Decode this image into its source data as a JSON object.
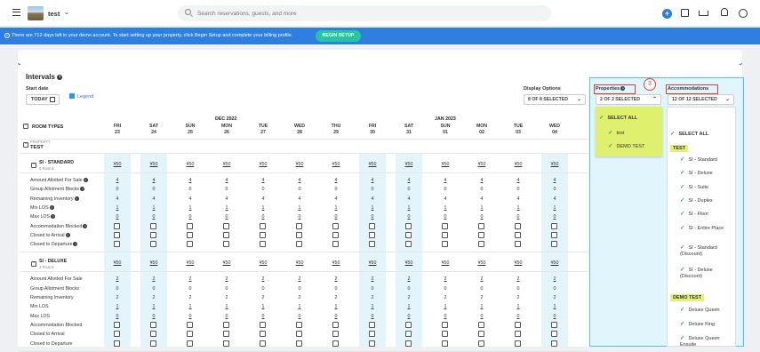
{
  "topbar": {
    "property_name": "test",
    "search_placeholder": "Search reservations, guests, and more"
  },
  "banner": {
    "info": "i",
    "message": "There are 712 days left in your demo account. To start setting up your property, click Begin Setup and complete your billing profile.",
    "button": "BEGIN SETUP"
  },
  "intervals": {
    "title": "Intervals",
    "start_date_label": "Start date",
    "today_button": "TODAY",
    "legend": "Legend",
    "display_options_label": "Display Options",
    "display_options_value": "8 OF 8 SELECTED",
    "properties_label": "Properties",
    "properties_value": "2 OF 2 SELECTED",
    "accommodations_label": "Accommodations",
    "accommodations_value": "12 OF 12 SELECTED",
    "room_types_header": "ROOM TYPES",
    "month1": "DEC 2022",
    "month2": "JAN 2023",
    "property_label": "PROPERTY",
    "property_name": "TEST"
  },
  "days": [
    [
      "FRI",
      "23"
    ],
    [
      "SAT",
      "24"
    ],
    [
      "SUN",
      "25"
    ],
    [
      "MON",
      "26"
    ],
    [
      "TUE",
      "27"
    ],
    [
      "WED",
      "28"
    ],
    [
      "THU",
      "29"
    ],
    [
      "FRI",
      "30"
    ],
    [
      "SAT",
      "31"
    ],
    [
      "SUN",
      "01"
    ],
    [
      "MON",
      "02"
    ],
    [
      "TUE",
      "03"
    ],
    [
      "WED",
      "04"
    ]
  ],
  "room_blocks": [
    {
      "name": "SI - STANDARD",
      "rooms": "4 Rooms",
      "rate": "¥50",
      "rows": [
        {
          "label": "Amount Allotted For Sale",
          "help": true,
          "value": "4",
          "type": "link"
        },
        {
          "label": "Group Allotment Blocks",
          "help": true,
          "value": "0",
          "type": "text"
        },
        {
          "label": "Remaining Inventory",
          "help": true,
          "value": "4",
          "type": "text"
        },
        {
          "label": "Min LOS",
          "help": true,
          "value": "1",
          "type": "link"
        },
        {
          "label": "Max LOS",
          "help": true,
          "value": "0",
          "type": "link"
        },
        {
          "label": "Accommodation Blocked",
          "help": true,
          "type": "check"
        },
        {
          "label": "Closed to Arrival",
          "help": true,
          "type": "check"
        },
        {
          "label": "Closed to Departure",
          "help": true,
          "type": "check"
        }
      ]
    },
    {
      "name": "SI - DELUXE",
      "rooms": "2 Rooms",
      "rate": "¥50",
      "rows": [
        {
          "label": "Amount Allotted For Sale",
          "value": "2",
          "type": "link"
        },
        {
          "label": "Group Allotment Blocks",
          "value": "0",
          "type": "text"
        },
        {
          "label": "Remaining Inventory",
          "value": "2",
          "type": "text"
        },
        {
          "label": "Min LOS",
          "value": "1",
          "type": "link"
        },
        {
          "label": "Max LOS",
          "value": "0",
          "type": "link"
        },
        {
          "label": "Accommodation Blocked",
          "type": "check"
        },
        {
          "label": "Closed to Arrival",
          "type": "check"
        },
        {
          "label": "Closed to Departure",
          "type": "check"
        }
      ]
    }
  ],
  "properties_menu": {
    "select_all": "SELECT ALL",
    "items": [
      "test",
      "DEMO TEST"
    ]
  },
  "accommodations_menu": {
    "select_all": "SELECT ALL",
    "groups": [
      {
        "name": "TEST",
        "items": [
          "SI - Standard",
          "SI - Deluxe",
          "SI - Suite",
          "SI - Duplex",
          "SI - Floor",
          "SI - Entire Place",
          "SI - Standard (Discount)",
          "SI - Deluxe (Discount)"
        ]
      },
      {
        "name": "DEMO TEST",
        "items": [
          "Deluxe Queen",
          "Deluxe King",
          "Deluxe Queen Ensuite"
        ]
      }
    ]
  },
  "annotation_step": "3",
  "colors": {
    "accent": "#2d7be3",
    "banner": "#2f7fe0",
    "begin_setup": "#24c7a2",
    "highlight_column": "#e4f4fb",
    "annotation": "#e53935",
    "selection_yellow": "#dff06e"
  }
}
